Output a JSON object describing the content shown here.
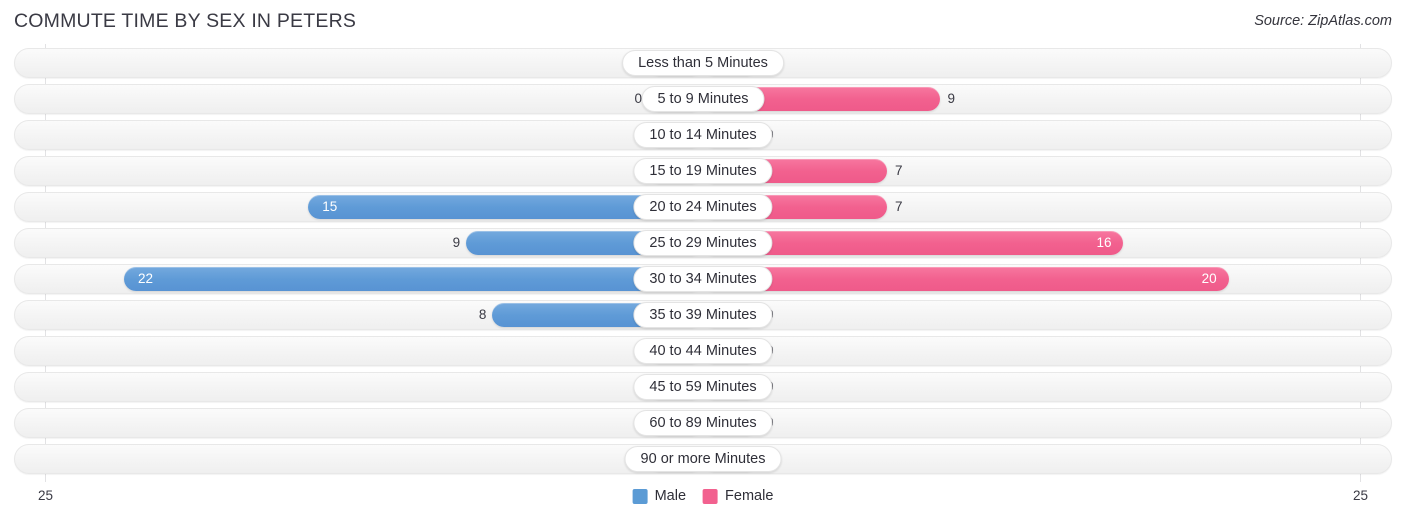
{
  "header": {
    "title": "COMMUTE TIME BY SEX IN PETERS",
    "source": "Source: ZipAtlas.com"
  },
  "legend": {
    "male_label": "Male",
    "female_label": "Female",
    "male_color": "#5b9bd5",
    "female_color": "#f2618f"
  },
  "axis": {
    "left_tick": "25",
    "right_tick": "25"
  },
  "chart_data": {
    "type": "bar",
    "orientation": "horizontal-diverging",
    "title": "COMMUTE TIME BY SEX IN PETERS",
    "xlabel": "",
    "ylabel": "",
    "xlim": [
      25,
      25
    ],
    "grid": true,
    "legend_position": "bottom-center",
    "categories": [
      "Less than 5 Minutes",
      "5 to 9 Minutes",
      "10 to 14 Minutes",
      "15 to 19 Minutes",
      "20 to 24 Minutes",
      "25 to 29 Minutes",
      "30 to 34 Minutes",
      "35 to 39 Minutes",
      "40 to 44 Minutes",
      "45 to 59 Minutes",
      "60 to 89 Minutes",
      "90 or more Minutes"
    ],
    "series": [
      {
        "name": "Male",
        "values": [
          0,
          0,
          0,
          0,
          15,
          9,
          22,
          8,
          0,
          0,
          0,
          0
        ]
      },
      {
        "name": "Female",
        "values": [
          0,
          9,
          0,
          7,
          7,
          16,
          20,
          0,
          0,
          0,
          0,
          0
        ]
      }
    ],
    "value_labels": {
      "male": [
        "0",
        "0",
        "0",
        "0",
        "15",
        "9",
        "22",
        "8",
        "0",
        "0",
        "0",
        "0"
      ],
      "female": [
        "0",
        "9",
        "0",
        "7",
        "7",
        "16",
        "20",
        "0",
        "0",
        "0",
        "0",
        "0"
      ]
    }
  }
}
